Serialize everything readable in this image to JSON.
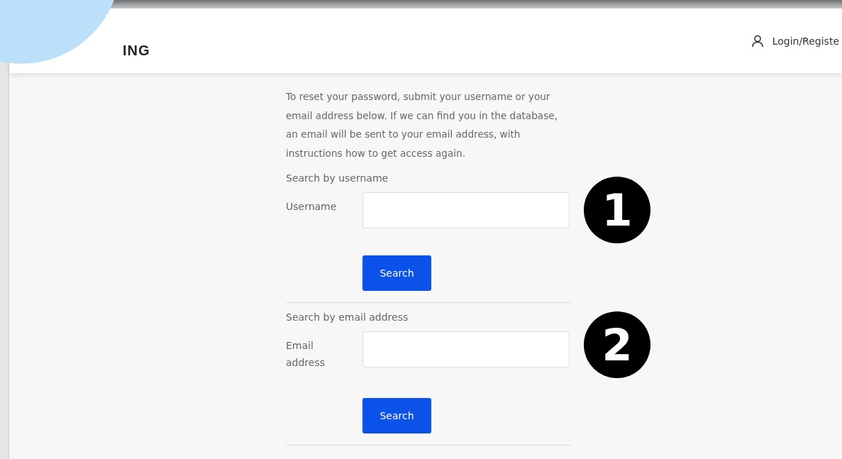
{
  "header": {
    "logo": "ING",
    "account_link": "Login/Registe"
  },
  "intro": "To reset your password, submit your username or your email address below. If we can find you in the database, an email will be sent to your email address, with instructions how to get access again.",
  "sections": [
    {
      "heading": "Search by username",
      "field_label": "Username",
      "button": "Search",
      "step": "1"
    },
    {
      "heading": "Search by email address",
      "field_label": "Email address",
      "button": "Search",
      "step": "2"
    }
  ]
}
